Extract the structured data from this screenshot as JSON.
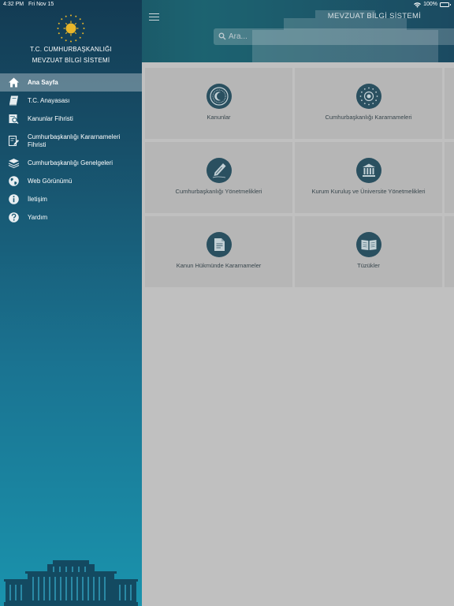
{
  "status": {
    "time": "4:32 PM",
    "date": "Fri Nov 15",
    "battery": "100%"
  },
  "header": {
    "title": "MEVZUAT BİLGİ SİSTEMİ",
    "search": {
      "placeholder": "Ara...",
      "value": ""
    }
  },
  "sidebar": {
    "org_name": "T.C. CUMHURBAŞKANLIĞI",
    "system_name": "MEVZUAT BİLGİ SİSTEMİ",
    "items": [
      {
        "label": "Ana Sayfa",
        "icon": "home-icon",
        "active": true
      },
      {
        "label": "T.C. Anayasası",
        "icon": "book-icon"
      },
      {
        "label": "Kanunlar Fihristi",
        "icon": "index-search-icon"
      },
      {
        "label": "Cumhurbaşkanlığı Kararnameleri Fihristi",
        "icon": "edit-document-icon"
      },
      {
        "label": "Cumhurbaşkanlığı Genelgeleri",
        "icon": "stack-icon"
      },
      {
        "label": "Web Görünümü",
        "icon": "globe-icon"
      },
      {
        "label": "İletişim",
        "icon": "info-icon"
      },
      {
        "label": "Yardım",
        "icon": "help-icon"
      }
    ]
  },
  "tiles": [
    {
      "label": "Kanunlar",
      "icon": "parliament-seal-icon"
    },
    {
      "label": "Cumhurbaşkanlığı Kararnameleri",
      "icon": "presidential-seal-icon"
    },
    {
      "label": "Cumhurbaşkanlığı Yönetmelikleri",
      "icon": "pen-icon"
    },
    {
      "label": "Kurum Kuruluş ve Üniversite Yönetmelikleri",
      "icon": "institution-icon"
    },
    {
      "label": "Kanun Hükmünde Kararnameler",
      "icon": "document-icon"
    },
    {
      "label": "Tüzükler",
      "icon": "open-book-icon"
    }
  ],
  "colors": {
    "sidebar_top": "#133b53",
    "sidebar_bottom": "#1a93ad",
    "header": "#1e6a78",
    "tile_icon": "#2d5566",
    "emblem_gold": "#e8b62a"
  }
}
